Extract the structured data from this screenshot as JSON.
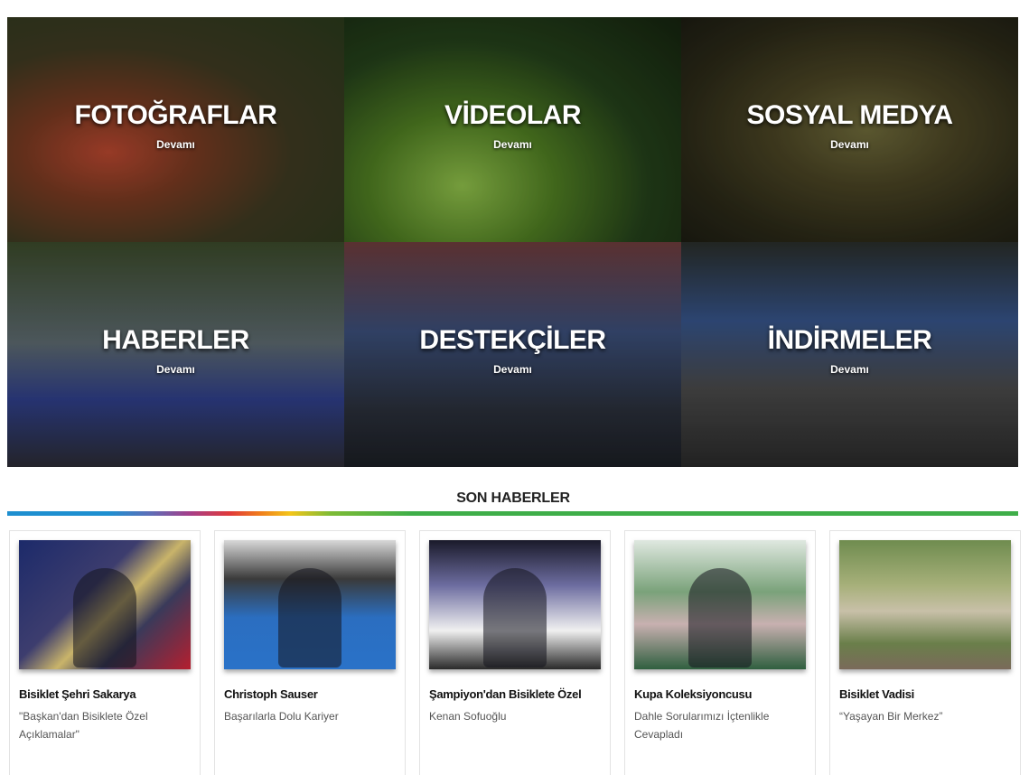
{
  "tiles": [
    {
      "title": "FOTOĞRAFLAR",
      "more": "Devamı"
    },
    {
      "title": "VİDEOLAR",
      "more": "Devamı"
    },
    {
      "title": "SOSYAL MEDYA",
      "more": "Devamı"
    },
    {
      "title": "HABERLER",
      "more": "Devamı"
    },
    {
      "title": "DESTEKÇİLER",
      "more": "Devamı"
    },
    {
      "title": "İNDİRMELER",
      "more": "Devamı"
    }
  ],
  "news": {
    "section_title": "SON HABERLER",
    "items": [
      {
        "title": "Bisiklet Şehri Sakarya",
        "subtitle": "\"Başkan'dan Bisiklete Özel Açıklamalar\""
      },
      {
        "title": "Christoph Sauser",
        "subtitle": "Başarılarla Dolu Kariyer"
      },
      {
        "title": "Şampiyon'dan Bisiklete Özel",
        "subtitle": "Kenan Sofuoğlu"
      },
      {
        "title": "Kupa Koleksiyoncusu",
        "subtitle": "Dahle Sorularımızı İçtenlikle Cevapladı"
      },
      {
        "title": "Bisiklet Vadisi",
        "subtitle": "“Yaşayan Bir Merkez”"
      }
    ]
  }
}
